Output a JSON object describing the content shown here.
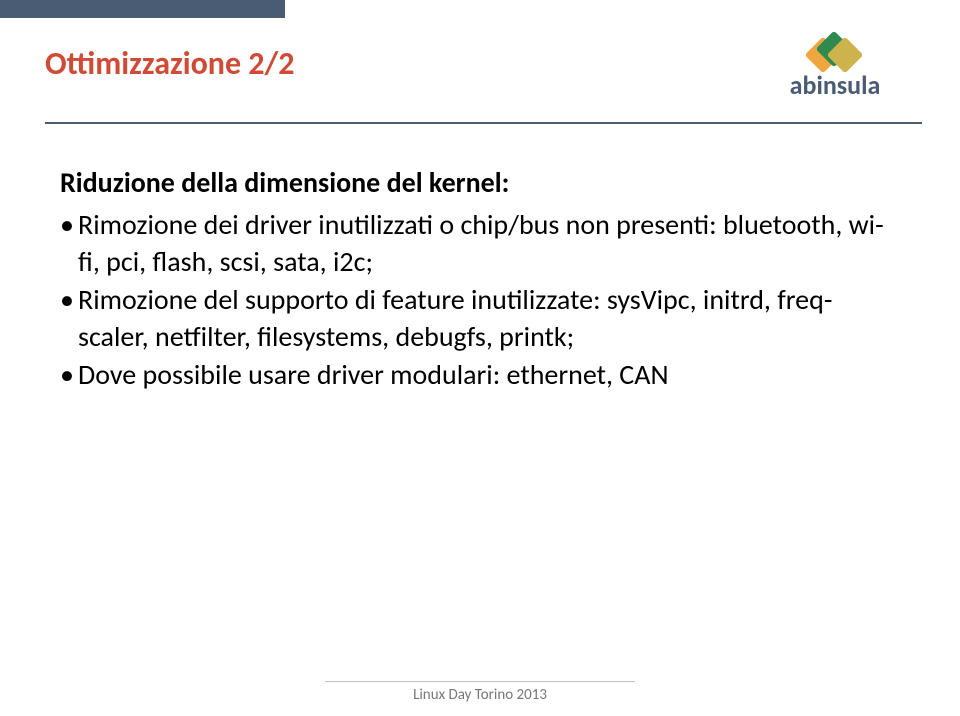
{
  "header": {
    "title": "Ottimizzazione 2/2",
    "brand": "abinsula"
  },
  "body": {
    "lead": "Riduzione della dimensione del kernel:",
    "bullets": [
      "Rimozione dei driver inutilizzati o chip/bus non presenti: bluetooth, wi-fi, pci, flash, scsi, sata, i2c;",
      "Rimozione del supporto di feature inutilizzate: sysVipc, initrd, freq-scaler, netfilter, filesystems, debugfs, printk;",
      "Dove possibile usare driver modulari: ethernet, CAN"
    ]
  },
  "footer": {
    "text": "Linux Day Torino 2013"
  }
}
